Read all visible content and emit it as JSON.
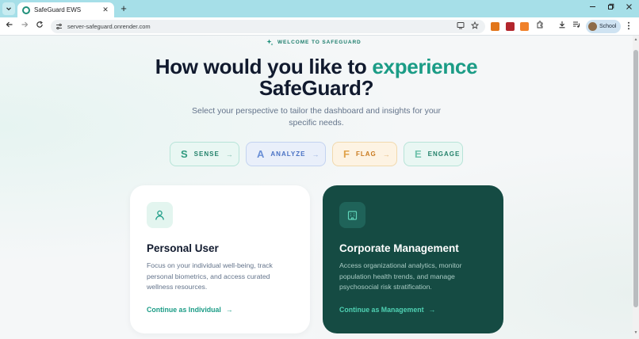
{
  "browser": {
    "tab_title": "SafeGuard EWS",
    "tab_close": "✕",
    "new_tab": "+",
    "url": "server-safeguard.onrender.com",
    "profile_name": "School"
  },
  "page": {
    "eyebrow": "WELCOME TO SAFEGUARD",
    "headline_part1": "How would you like to",
    "headline_accent": "experience",
    "headline_part2": "SafeGuard?",
    "subtitle": "Select your perspective to tailor the dashboard and insights for your specific needs.",
    "modes": [
      {
        "letter": "S",
        "label": "SENSE",
        "arrow": "→"
      },
      {
        "letter": "A",
        "label": "ANALYZE",
        "arrow": "→"
      },
      {
        "letter": "F",
        "label": "FLAG",
        "arrow": "→"
      },
      {
        "letter": "E",
        "label": "ENGAGE"
      }
    ],
    "cards": {
      "personal": {
        "title": "Personal User",
        "description": "Focus on your individual well-being, track personal biometrics, and access curated wellness resources.",
        "cta": "Continue as Individual",
        "arrow": "→"
      },
      "corporate": {
        "title": "Corporate Management",
        "description": "Access organizational analytics, monitor population health trends, and manage psychosocial risk stratification.",
        "cta": "Continue as Management",
        "arrow": "→"
      }
    }
  },
  "colors": {
    "accent": "#1b9c86",
    "dark_card": "#154b43",
    "heading": "#111a2e",
    "sense": "#2f9a7f",
    "analyze": "#4a72c4",
    "flag": "#c97a1f",
    "engage": "#2f9a7f"
  },
  "icons": [
    "chevron-down-icon",
    "back-arrow-icon",
    "forward-arrow-icon",
    "reload-icon",
    "site-info-icon",
    "install-icon",
    "star-icon",
    "extensions-icon",
    "download-icon",
    "media-icon",
    "menu-icon",
    "sparkle-icon",
    "user-icon",
    "building-icon"
  ]
}
